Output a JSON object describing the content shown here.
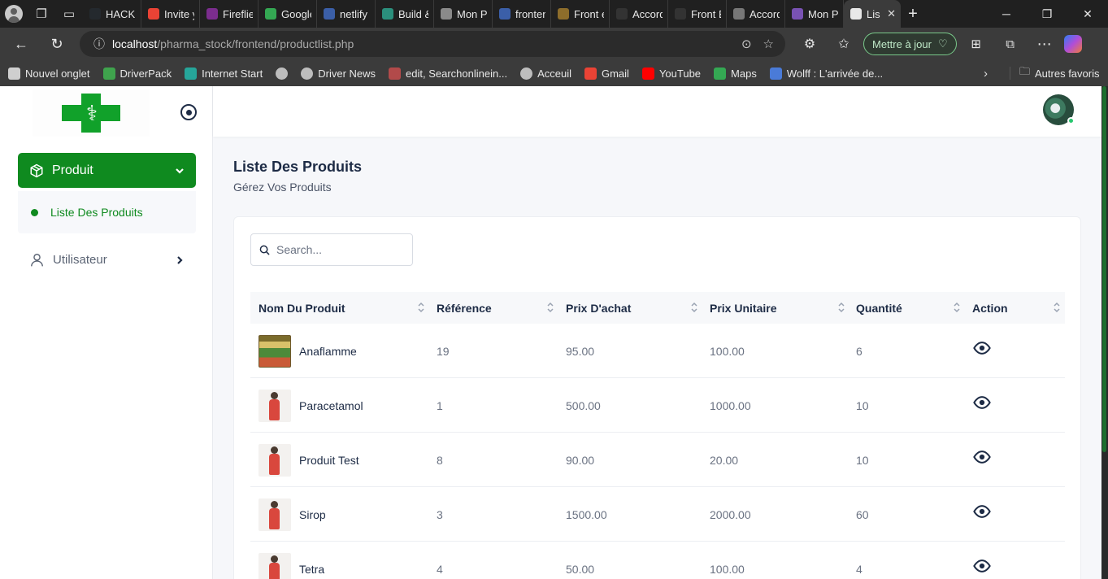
{
  "browser": {
    "tabs": [
      {
        "title": "HACKE",
        "icon": "github-icon",
        "color": "#24292e"
      },
      {
        "title": "Invite y",
        "icon": "gmail-icon",
        "color": "#ea4335"
      },
      {
        "title": "Fireflie",
        "icon": "fireflies-icon",
        "color": "#7b2d8e"
      },
      {
        "title": "Google",
        "icon": "google-icon",
        "color": "#34a853"
      },
      {
        "title": "netlify a",
        "icon": "search-icon",
        "color": "#3b5fa8"
      },
      {
        "title": "Build &",
        "icon": "netlify-icon",
        "color": "#2b8f7c"
      },
      {
        "title": "Mon Po",
        "icon": "globe-icon",
        "color": "#8a8a8a"
      },
      {
        "title": "fronten",
        "icon": "search-icon",
        "color": "#3b5fa8"
      },
      {
        "title": "Front e",
        "icon": "bookmark-icon",
        "color": "#8d6d2b"
      },
      {
        "title": "Accordi",
        "icon": "code-icon",
        "color": "#333333"
      },
      {
        "title": "Front E",
        "icon": "code-icon",
        "color": "#333333"
      },
      {
        "title": "Accord",
        "icon": "settings-icon",
        "color": "#777777"
      },
      {
        "title": "Mon Po",
        "icon": "bootstrap-icon",
        "color": "#7952b3"
      },
      {
        "title": "Lis",
        "icon": "pharmacy-icon",
        "color": "#e8e8e8",
        "active": true
      }
    ],
    "address": {
      "host": "localhost",
      "path": "/pharma_stock/frontend/productlist.php"
    },
    "update_label": "Mettre à jour",
    "bookmarks": [
      {
        "label": "Nouvel onglet",
        "icon": "new-tab-icon",
        "color": "#cfcfcf"
      },
      {
        "label": "DriverPack",
        "icon": "driverpack-icon",
        "color": "#3fa34d"
      },
      {
        "label": "Internet Start",
        "icon": "internet-start-icon",
        "color": "#26a69a"
      },
      {
        "label": "",
        "icon": "globe-icon",
        "color": "#bdbdbd"
      },
      {
        "label": "Driver News",
        "icon": "globe-icon",
        "color": "#bdbdbd"
      },
      {
        "label": "edit, Searchonlinein...",
        "icon": "search-site-icon",
        "color": "#b24a4a"
      },
      {
        "label": "Acceuil",
        "icon": "globe-icon",
        "color": "#bdbdbd"
      },
      {
        "label": "Gmail",
        "icon": "gmail-icon",
        "color": "#ea4335"
      },
      {
        "label": "YouTube",
        "icon": "youtube-icon",
        "color": "#ff0000"
      },
      {
        "label": "Maps",
        "icon": "maps-icon",
        "color": "#34a853"
      },
      {
        "label": "Wolff : L'arrivée de...",
        "icon": "wolff-icon",
        "color": "#4a7bd8"
      }
    ],
    "other_bookmarks": "Autres favoris"
  },
  "sidebar": {
    "menu_produit": "Produit",
    "submenu_liste": "Liste Des Produits",
    "menu_utilisateur": "Utilisateur"
  },
  "page": {
    "title": "Liste Des Produits",
    "subtitle": "Gérez Vos Produits"
  },
  "search": {
    "placeholder": "Search..."
  },
  "table": {
    "columns": [
      "Nom Du Produit",
      "Référence",
      "Prix D'achat",
      "Prix Unitaire",
      "Quantité",
      "Action"
    ],
    "rows": [
      {
        "name": "Anaflamme",
        "ref": "19",
        "achat": "95.00",
        "unitaire": "100.00",
        "qte": "6",
        "image": "store"
      },
      {
        "name": "Paracetamol",
        "ref": "1",
        "achat": "500.00",
        "unitaire": "1000.00",
        "qte": "10",
        "image": "person"
      },
      {
        "name": "Produit Test",
        "ref": "8",
        "achat": "90.00",
        "unitaire": "20.00",
        "qte": "10",
        "image": "person"
      },
      {
        "name": "Sirop",
        "ref": "3",
        "achat": "1500.00",
        "unitaire": "2000.00",
        "qte": "60",
        "image": "person"
      },
      {
        "name": "Tetra",
        "ref": "4",
        "achat": "50.00",
        "unitaire": "100.00",
        "qte": "4",
        "image": "person"
      }
    ]
  },
  "colors": {
    "brand": "#0f8a1f",
    "text_dark": "#1d2b45",
    "text_muted": "#6a7282"
  }
}
